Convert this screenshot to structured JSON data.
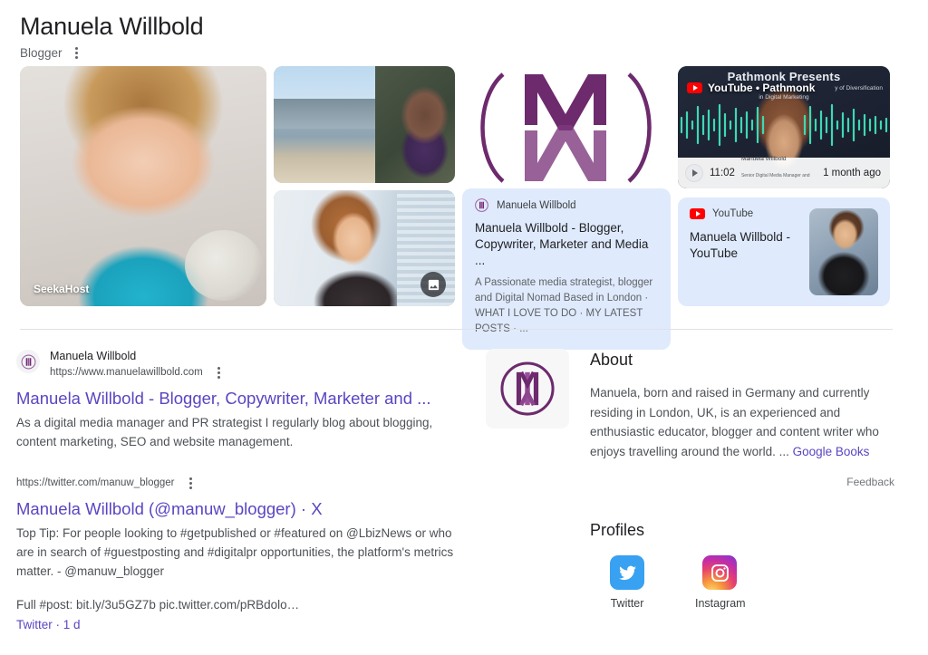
{
  "header": {
    "title": "Manuela Willbold",
    "subtitle": "Blogger",
    "more_label": "More options"
  },
  "media": {
    "main_photo_watermark": "SeekaHost",
    "photo_alt_main": "portrait-photo",
    "photo_alt_thames": "thames-riverside-photo",
    "photo_alt_phone": "woman-on-phone-photo",
    "stack_badge": "image-stack-icon",
    "logo_alt": "mw-monogram-logo"
  },
  "site_card": {
    "source_name": "Manuela Willbold",
    "title": "Manuela Willbold - Blogger, Copywriter, Marketer and Media ...",
    "snippet": "A Passionate media strategist, blogger and Digital Nomad Based in London · WHAT I LOVE TO DO · MY LATEST POSTS · ..."
  },
  "video": {
    "headline": "Pathmonk Presents",
    "sub_right": "y of Diversification",
    "sub_center": "in Digital Marketing",
    "pill_label": "YouTube • Pathmonk",
    "duration": "11:02",
    "uploader": "Manuela Willbold",
    "uploader_role": "Senior Digital Media Manager and Marketing Strategist",
    "age": "1 month ago"
  },
  "youtube_card": {
    "source_name": "YouTube",
    "title": "Manuela Willbold - YouTube"
  },
  "results": [
    {
      "site": "Manuela Willbold",
      "url": "https://www.manuelawillbold.com",
      "title": "Manuela Willbold - Blogger, Copywriter, Marketer and ...",
      "snippet": "As a digital media manager and PR strategist I regularly blog about blogging, content marketing, SEO and website management."
    },
    {
      "site": "",
      "url": "https://twitter.com/manuw_blogger",
      "title": "Manuela Willbold (@manuw_blogger) · X",
      "snippet": "Top Tip: For people looking to #getpublished or #featured on @LbizNews or who are in search of #guestposting and #digitalpr opportunities, the platform's metrics matter. - @manuw_blogger",
      "extra": "Full #post: bit.ly/3u5GZ7b pic.twitter.com/pRBdolo…",
      "footer_link": "Twitter · 1 d"
    }
  ],
  "rail": {
    "about_heading": "About",
    "about_text": "Manuela, born and raised in Germany and currently residing in London, UK, is an experienced and enthusiastic educator, blogger and content writer who enjoys travelling around the world. ... ",
    "about_link": "Google Books",
    "feedback": "Feedback",
    "profiles_heading": "Profiles",
    "profiles": [
      {
        "label": "Twitter",
        "icon": "twitter-icon"
      },
      {
        "label": "Instagram",
        "icon": "instagram-icon"
      }
    ]
  },
  "colors": {
    "card_blue": "#dfeafc",
    "link_purple": "#5b45c2",
    "brand_purple": "#6d2a6d",
    "youtube_red": "#ff0000",
    "twitter_blue": "#38a1f1"
  }
}
